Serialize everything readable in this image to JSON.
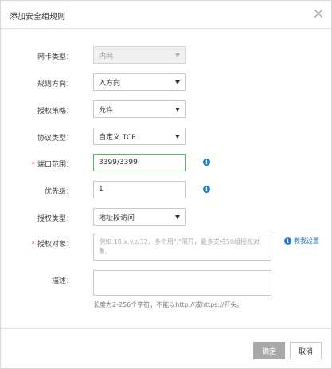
{
  "dialog": {
    "title": "添加安全组规则"
  },
  "form": {
    "nic_type": {
      "label": "网卡类型：",
      "value": "内网"
    },
    "rule_direction": {
      "label": "规则方向：",
      "value": "入方向"
    },
    "auth_policy": {
      "label": "授权策略：",
      "value": "允许"
    },
    "protocol_type": {
      "label": "协议类型：",
      "value": "自定义 TCP"
    },
    "port_range": {
      "label": "端口范围：",
      "required_mark": "*",
      "value": "3399/3399"
    },
    "priority": {
      "label": "优先级：",
      "value": "1"
    },
    "auth_type": {
      "label": "授权类型：",
      "value": "地址段访问"
    },
    "auth_object": {
      "label": "授权对象：",
      "required_mark": "*",
      "placeholder": "例如:10.x.y.z/32，多个用\",\"隔开，最多支持50组授权对象。"
    },
    "description": {
      "label": "描述：",
      "hint": "长度为2-256个字符，不能以http://或https://开头。"
    },
    "help_link": "教我设置",
    "info_glyph": "i"
  },
  "footer": {
    "confirm_label": "确定",
    "cancel_label": "取消"
  },
  "colors": {
    "link": "#1d7ad4",
    "required": "#e5484d",
    "active_border": "#5ab45a",
    "disabled_button": "#a8a8a8"
  }
}
